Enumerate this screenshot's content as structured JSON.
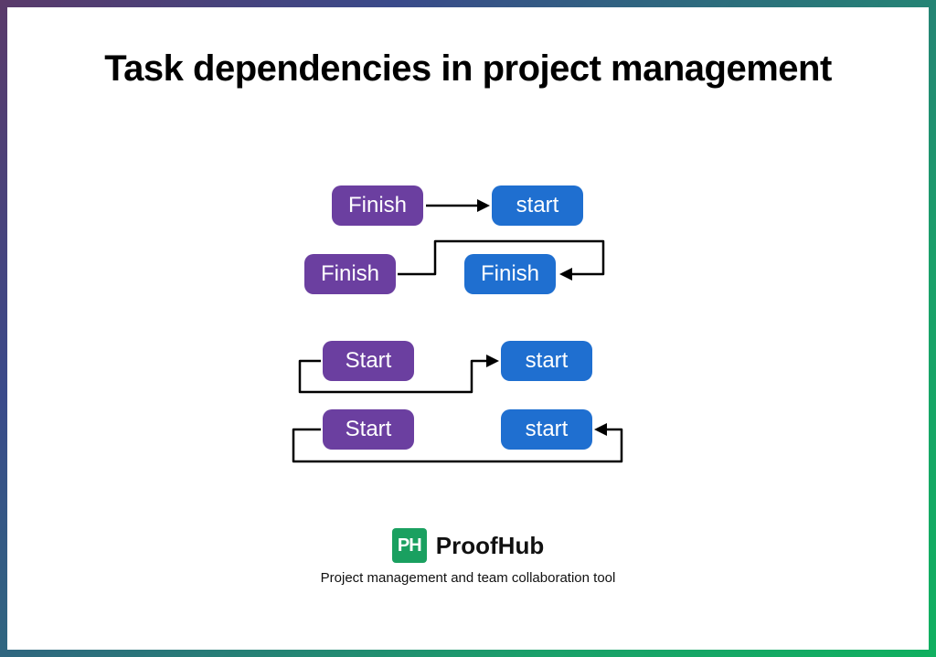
{
  "title": "Task dependencies in project management",
  "rows": [
    {
      "left": "Finish",
      "right": "start"
    },
    {
      "left": "Finish",
      "right": "Finish"
    },
    {
      "left": "Start",
      "right": "start"
    },
    {
      "left": "Start",
      "right": "start"
    }
  ],
  "brand": {
    "logo_text": "PH",
    "name": "ProofHub",
    "tagline": "Project management and team collaboration tool"
  },
  "colors": {
    "purple": "#6b3fa0",
    "blue": "#1f6fd0",
    "logo_green": "#1aa060"
  }
}
